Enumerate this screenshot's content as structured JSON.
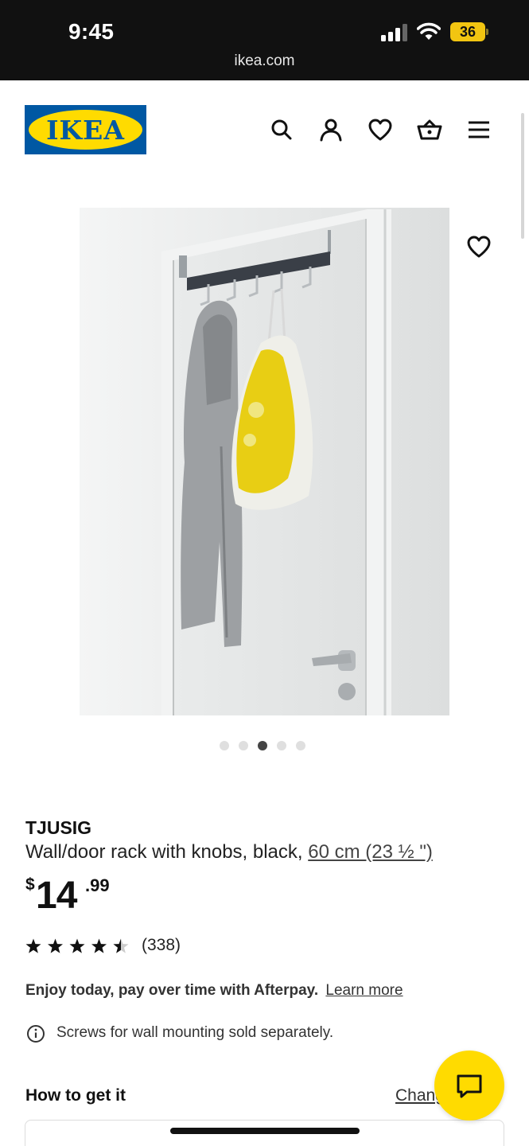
{
  "status_bar": {
    "time": "9:45",
    "url": "ikea.com",
    "battery": "36"
  },
  "header": {
    "logo_text": "IKEA",
    "icons": [
      "search-icon",
      "account-icon",
      "heart-icon",
      "basket-icon",
      "menu-icon"
    ]
  },
  "gallery": {
    "image_count": 5,
    "active_index": 2
  },
  "product": {
    "name": "TJUSIG",
    "description": "Wall/door rack with knobs, black,",
    "size": "60 cm (23 ½ \")",
    "price_currency": "$",
    "price_integer": "14",
    "price_decimal": ".99",
    "rating": 4.5,
    "rating_count": "(338)"
  },
  "afterpay": {
    "text": "Enjoy today, pay over time with Afterpay.",
    "link": "Learn more"
  },
  "notice": "Screws for wall mounting sold separately.",
  "delivery": {
    "heading": "How to get it",
    "change_link": "Change store"
  },
  "colors": {
    "brand_blue": "#0058a3",
    "brand_yellow": "#ffdb00"
  }
}
